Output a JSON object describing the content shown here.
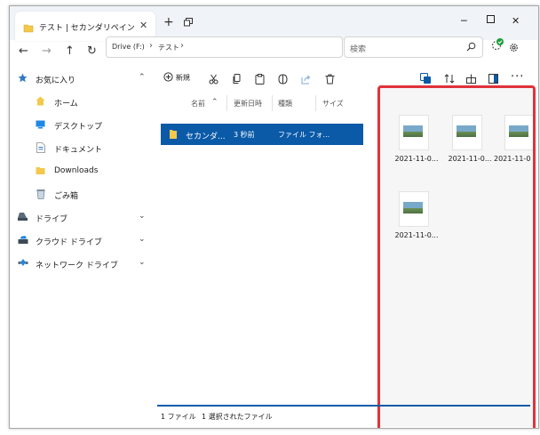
{
  "tab": {
    "title": "テスト | セカンダリペイン"
  },
  "address": {
    "drive": "Drive (F:)",
    "folder": "テスト"
  },
  "search": {
    "placeholder": "検索"
  },
  "toolbar": {
    "new_label": "新規"
  },
  "sidebar": {
    "items": [
      {
        "label": "お気に入り",
        "icon": "star-icon"
      },
      {
        "label": "ホーム",
        "icon": "home-icon"
      },
      {
        "label": "デスクトップ",
        "icon": "desktop-icon"
      },
      {
        "label": "ドキュメント",
        "icon": "document-icon"
      },
      {
        "label": "Downloads",
        "icon": "downloads-folder-icon"
      },
      {
        "label": "ごみ箱",
        "icon": "recycle-bin-icon"
      },
      {
        "label": "ドライブ",
        "icon": "drive-icon"
      },
      {
        "label": "クラウド ドライブ",
        "icon": "cloud-drive-icon"
      },
      {
        "label": "ネットワーク ドライブ",
        "icon": "network-icon"
      }
    ]
  },
  "filelist": {
    "columns": [
      "名前",
      "更新日時",
      "種類",
      "サイズ"
    ],
    "rows": [
      {
        "name": "セカンダ...",
        "modified": "3 秒前",
        "type": "ファイル フォ..."
      }
    ]
  },
  "preview": {
    "items": [
      {
        "name": "2021-11-0..."
      },
      {
        "name": "2021-11-0..."
      },
      {
        "name": "2021-11-0"
      },
      {
        "name": "2021-11-0..."
      }
    ]
  },
  "status": {
    "count": "1 ファイル",
    "selected": "1 選択されたファイル"
  },
  "colors": {
    "accent": "#0a5aa8",
    "highlight_border": "#e0333a",
    "folder": "#f3c84b"
  }
}
